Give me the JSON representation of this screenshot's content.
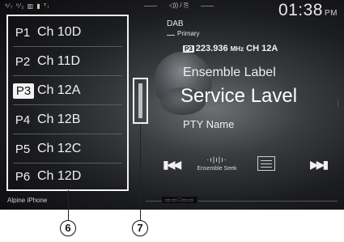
{
  "status": {
    "left_icons": "⁹⁄₇ ⁰⁄₂ ▥ ▮ ᵀₗ",
    "center_icons": "◁)) / ⎘",
    "time": "01:38",
    "ampm": "PM"
  },
  "presets": [
    {
      "num": "P1",
      "channel": "Ch 10D",
      "active": false
    },
    {
      "num": "P2",
      "channel": "Ch 11D",
      "active": false
    },
    {
      "num": "P3",
      "channel": "Ch 12A",
      "active": true
    },
    {
      "num": "P4",
      "channel": "Ch 12B",
      "active": false
    },
    {
      "num": "P5",
      "channel": "Ch 12C",
      "active": false
    },
    {
      "num": "P6",
      "channel": "Ch 12D",
      "active": false
    }
  ],
  "station": {
    "band": "DAB",
    "primary": "Primary",
    "badge": "P3",
    "frequency": "223.936",
    "freq_unit": "MHz",
    "channel": "CH 12A",
    "ensemble": "Ensemble Label",
    "service": "Service Lavel",
    "pty": "PTY Name"
  },
  "controls": {
    "prev_icon": "skip-back-icon",
    "prev_glyph": "▮◀◀",
    "seek_glyph": "·ı|ı|ı·",
    "seek_label": "Ensemble Seek",
    "fav_icon": "preset-list-icon",
    "next_icon": "skip-forward-icon",
    "next_glyph": "▶▶▮"
  },
  "bottom": {
    "source": "Alpine iPhone",
    "indicator": "▭▭□▭▭"
  },
  "callouts": [
    "6",
    "7"
  ]
}
